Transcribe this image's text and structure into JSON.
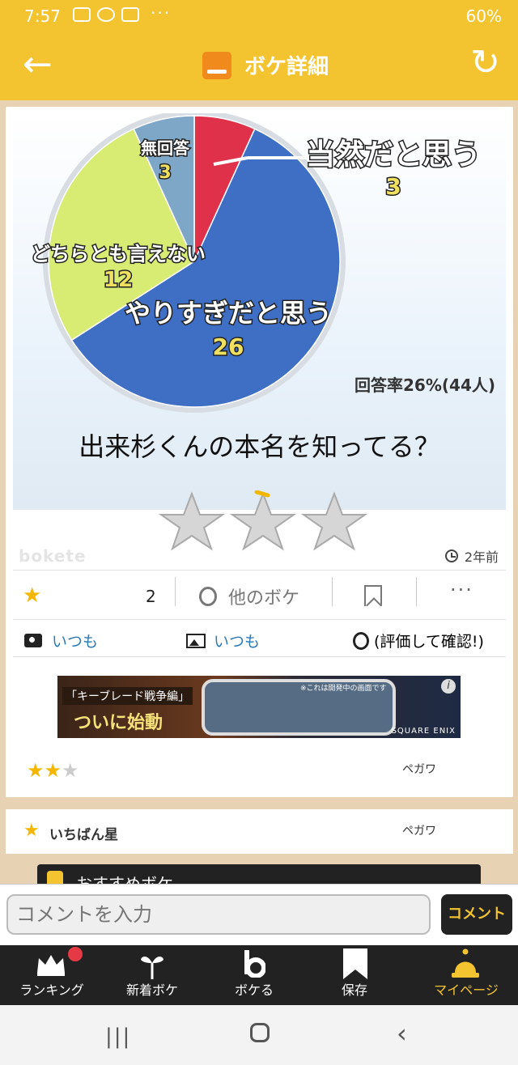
{
  "status_bar": {
    "time": "7:57",
    "dots": "···",
    "battery": "60%"
  },
  "app_bar": {
    "title": "ボケ詳細"
  },
  "chart_data": {
    "type": "pie",
    "categories": [
      "当然だと思う",
      "やりすぎだと思う",
      "どちらとも言えない",
      "無回答"
    ],
    "values": [
      3,
      26,
      12,
      3
    ],
    "colors": [
      "#e0314a",
      "#3f6fc4",
      "#d8ec74",
      "#7ea7c7"
    ],
    "note": "回答率26%(44人)"
  },
  "post": {
    "caption": "出来杉くんの本名を知ってる？",
    "logo_text": "bokete",
    "time_ago": "2年前",
    "favorites": "2",
    "other_boke": "他のボケ",
    "more": "···"
  },
  "meta": {
    "photo_by": "いつも",
    "image_by": "いつも",
    "rating_hint": "(評価して確認!)"
  },
  "ad": {
    "tag": "「キーブレード戦争編」",
    "headline": "ついに始動",
    "note": "※これは開発中の画面です",
    "brand": "SQUARE ENIX",
    "info": "i"
  },
  "score": {
    "stars_on": 2,
    "stars_total": 3,
    "user": "ペガワ"
  },
  "best_star": {
    "label": "いちばん星",
    "user": "ペガワ"
  },
  "recommend": {
    "title": "おすすめボケ"
  },
  "comment": {
    "placeholder": "コメントを入力",
    "button": "コメント"
  },
  "nav": [
    {
      "label": "ランキング",
      "icon": "crown-icon"
    },
    {
      "label": "新着ボケ",
      "icon": "sprout-icon"
    },
    {
      "label": "ボケる",
      "icon": "bokete-b-icon"
    },
    {
      "label": "保存",
      "icon": "bookmark-icon"
    },
    {
      "label": "マイページ",
      "icon": "bell-icon"
    }
  ]
}
